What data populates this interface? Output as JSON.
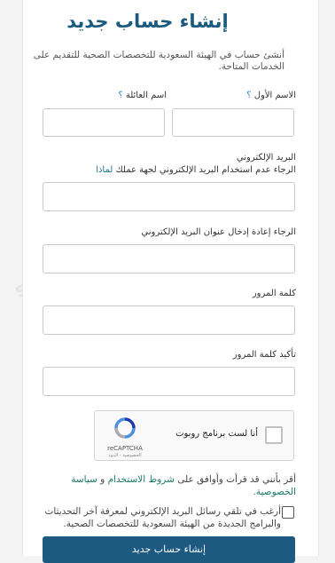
{
  "page": {
    "title": "إنشاء حساب جديد",
    "intro": "أنشئ حساب في الهيئة السعودية للتخصصات الصحية للتقديم على الخدمات المتاحة."
  },
  "form": {
    "first_name_label": "الاسم الأول",
    "family_name_label": "اسم العائلة",
    "required_marker": "؟",
    "email_label": "البريد الإلكتروني",
    "email_help": "الرجاء عدم استخدام البريد الإلكتروني لجهة عملك",
    "email_help_link": "لماذا",
    "confirm_email_label": "الرجاء إعادة إدخال عنوان البريد الإلكتروني",
    "password_label": "كلمة المرور",
    "confirm_password_label": "تأكيد كلمة المرور"
  },
  "recaptcha": {
    "label": "أنا لست برنامج روبوت",
    "brand": "reCAPTCHA",
    "links": "الخصوصية - البنود"
  },
  "terms": {
    "prefix": "أقر بأنني قد قرأت وأوافق على",
    "terms_link": "شروط الاستخدام",
    "conj": "و",
    "privacy_link": "سياسة الخصوصية."
  },
  "newsletter": {
    "label": "أرغب في تلقي رسائل البريد الإلكتروني لمعرفة آخر التحديثات والبرامج الجديدة من الهيئة السعودية للتخصصات الصحية."
  },
  "submit": {
    "label": "إنشاء حساب جديد"
  },
  "watermark": {
    "text": "sfhaat.com"
  },
  "colors": {
    "accent": "#1c5a82",
    "link": "#1a7a6a",
    "required": "#2a8ab0"
  }
}
